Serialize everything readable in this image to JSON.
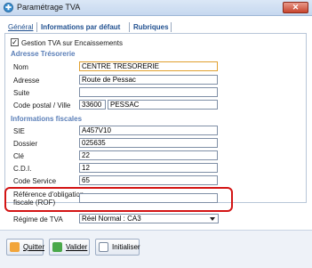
{
  "window": {
    "title": "Paramétrage TVA",
    "close_glyph": "✕"
  },
  "tabs": [
    {
      "label": "Général"
    },
    {
      "label": "Informations par défaut"
    },
    {
      "label": "Rubriques"
    }
  ],
  "gestion": {
    "label": "Gestion TVA sur Encaissements",
    "checked": true,
    "check_glyph": "✓"
  },
  "tresorerie": {
    "section_title": "Adresse Trésorerie",
    "nom_label": "Nom",
    "nom_value": "CENTRE TRESORERIE",
    "adresse_label": "Adresse",
    "adresse_value": "Route de Pessac",
    "suite_label": "Suite",
    "suite_value": "",
    "cp_label": "Code postal / Ville",
    "cp_value": "33600",
    "ville_value": "PESSAC"
  },
  "fiscales": {
    "section_title": "Informations fiscales",
    "sie_label": "SIE",
    "sie_value": "A457V10",
    "dossier_label": "Dossier",
    "dossier_value": "025635",
    "cle_label": "Clé",
    "cle_value": "22",
    "cdi_label": "C.D.I.",
    "cdi_value": "12",
    "code_service_label": "Code Service",
    "code_service_value": "65",
    "rof_label_1": "Référence d'obligation",
    "rof_label_2": "fiscale (ROF)",
    "rof_value": "",
    "regime_label": "Régime de TVA",
    "regime_value": "Réel Normal : CA3"
  },
  "buttons": {
    "quitter": "Quitter",
    "valider": "Valider",
    "initialiser": "Initialiser"
  },
  "colors": {
    "highlight": "#d31414",
    "section": "#5b7fb8",
    "tab_text": "#1f4f8f"
  }
}
